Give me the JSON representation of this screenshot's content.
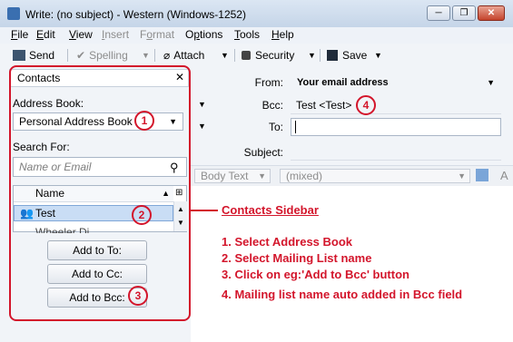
{
  "window": {
    "title": "Write: (no subject) - Western (Windows-1252)",
    "min": "─",
    "max": "❐",
    "close": "✕"
  },
  "menu": [
    {
      "key": "F",
      "rest": "ile"
    },
    {
      "key": "E",
      "rest": "dit"
    },
    {
      "key": "V",
      "rest": "iew"
    },
    {
      "key": "I",
      "rest": "nsert"
    },
    {
      "key": "o",
      "pre": "F",
      "rest": "rmat"
    },
    {
      "key": "p",
      "pre": "O",
      "rest": "tions"
    },
    {
      "key": "T",
      "rest": "ools"
    },
    {
      "key": "H",
      "rest": "elp"
    }
  ],
  "toolbar": {
    "send": "Send",
    "spelling": "Spelling",
    "attach": "Attach",
    "security": "Security",
    "save": "Save"
  },
  "sidebar": {
    "title": "Contacts",
    "address_book_label": "Address Book:",
    "address_book_value": "Personal Address Book",
    "search_label": "Search For:",
    "search_placeholder": "Name or Email",
    "list_header": "Name",
    "rows": [
      "Test",
      "Wheeler Di..."
    ],
    "add_to": "Add to To:",
    "add_cc": "Add to Cc:",
    "add_bcc": "Add to Bcc:"
  },
  "header": {
    "from_label": "From:",
    "from_value": "Your email address",
    "bcc_label": "Bcc:",
    "bcc_value": "Test <Test>",
    "to_label": "To:",
    "to_value": "",
    "subject_label": "Subject:",
    "format_value": "Body Text",
    "font_value": "(mixed)"
  },
  "annotations": {
    "n1": "1",
    "n2": "2",
    "n3": "3",
    "n4": "4",
    "title": "Contacts Sidebar",
    "step1": "1.  Select Address Book",
    "step2": "2.  Select Mailing List name",
    "step3": "3.  Click on eg:'Add to Bcc' button",
    "step4": "4.  Mailing list name auto added in Bcc field"
  },
  "colors": {
    "annotation": "#d3152b",
    "selection": "#c9ddf5"
  }
}
